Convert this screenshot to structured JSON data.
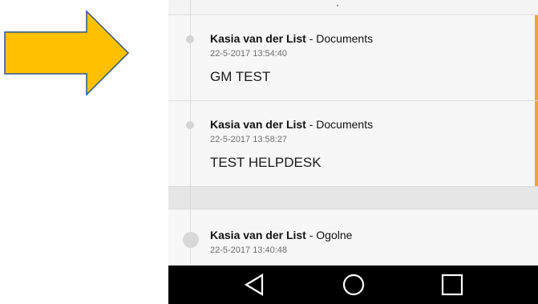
{
  "colors": {
    "arrow_fill": "#FFC000",
    "arrow_stroke": "#2F528F",
    "unread_bar": "#F0A23A",
    "navbar": "#000000"
  },
  "entries": [
    {
      "author": "Kasia van der List",
      "separator": " - ",
      "category": "Documents",
      "timestamp": "22-5-2017 13:54:40",
      "message": "GM TEST"
    },
    {
      "author": "Kasia van der List",
      "separator": " - ",
      "category": "Documents",
      "timestamp": "22-5-2017 13:58:27",
      "message": "TEST HELPDESK"
    },
    {
      "author": "Kasia van der List",
      "separator": " - ",
      "category": "Ogolne",
      "timestamp": "22-5-2017 13:40:48",
      "message": ""
    }
  ],
  "navigation": {
    "back_icon": "back-triangle-icon",
    "home_icon": "home-circle-icon",
    "recent_icon": "recent-apps-square-icon"
  }
}
